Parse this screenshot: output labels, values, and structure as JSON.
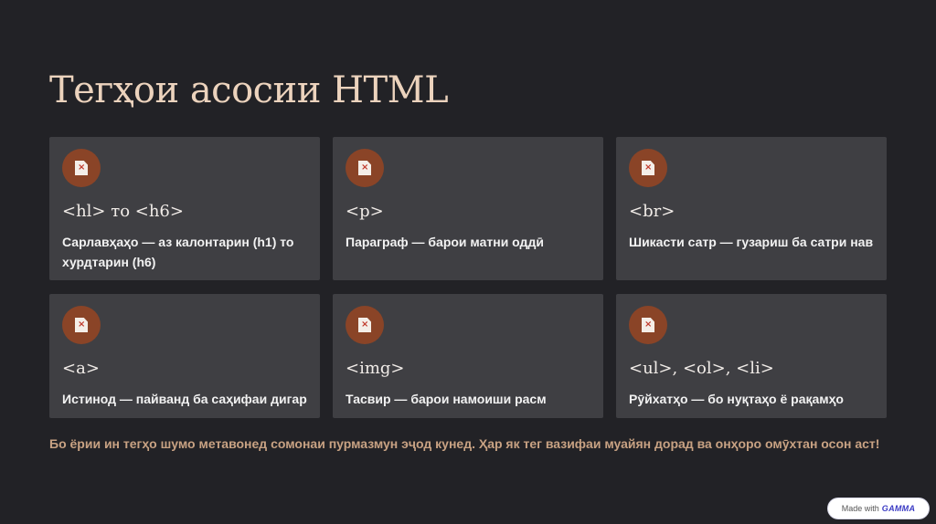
{
  "slide": {
    "title": "Тегҳои асосии HTML",
    "cards": [
      {
        "tag": "<hl> то <h6>",
        "description": "Сарлавҳаҳо — аз калонтарин (h1) то хурдтарин (h6)"
      },
      {
        "tag": "<p>",
        "description": "Параграф — барои матни оддӣ"
      },
      {
        "tag": "<br>",
        "description": "Шикасти сатр — гузариш ба сатри нав"
      },
      {
        "tag": "<a>",
        "description": "Истинод — пайванд ба саҳифаи дигар"
      },
      {
        "tag": "<img>",
        "description": "Тасвир — барои намоиши расм"
      },
      {
        "tag": "<ul>, <ol>, <li>",
        "description": "Рӯйхатҳо — бо нуқтаҳо ё рақамҳо"
      }
    ],
    "footer": "Бо ёрии ин тегҳо шумо метавонед сомонаи пурмазмун эҷод кунед. Ҳар як тег вазифаи муайян дорад ва онҳоро омӯхтан осон аст!"
  },
  "badge": {
    "prefix": "Made with",
    "brand": "GAMMA"
  },
  "icons": {
    "card_icon": "broken-image-icon"
  },
  "colors": {
    "background": "#222226",
    "card": "#3f3f43",
    "accent": "#8a4427",
    "title": "#ecd3bd",
    "footer": "#c8a283"
  }
}
